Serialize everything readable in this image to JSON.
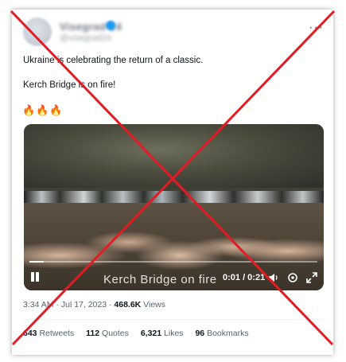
{
  "tweet": {
    "author_name": "Visegrad 24",
    "author_handle": "@visegrad24",
    "more_icon": "more-icon",
    "text_line1": "Ukraine is celebrating the return of a classic.",
    "text_line2": "Kerch Bridge is on fire!",
    "emoji": "🔥🔥🔥",
    "timestamp": "3:34 AM · Jul 17, 2023 · ",
    "views_count": "468.6K",
    "views_label": " Views"
  },
  "video": {
    "caption": "Kerch Bridge on fire",
    "time": "0:01 / 0:21",
    "progress": 0.05,
    "controls": [
      "pause-icon",
      "volume-icon",
      "settings-icon",
      "fullscreen-icon"
    ]
  },
  "stats": [
    {
      "count": "643",
      "label": "Retweets"
    },
    {
      "count": "112",
      "label": "Quotes"
    },
    {
      "count": "6,321",
      "label": "Likes"
    },
    {
      "count": "96",
      "label": "Bookmarks"
    }
  ],
  "overlay": {
    "type": "red-cross",
    "color": "#e31b23"
  }
}
